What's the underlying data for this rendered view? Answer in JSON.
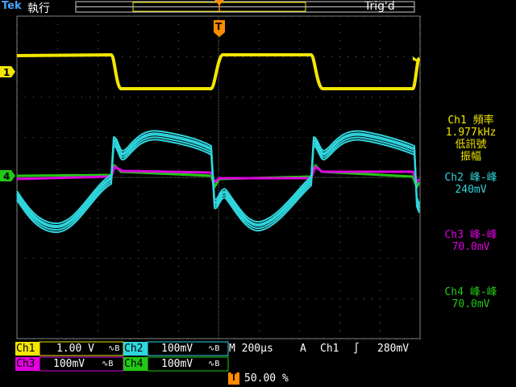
{
  "header": {
    "brand": "Tek",
    "mode": "執行",
    "trigger_status": "Trig'd"
  },
  "markers": {
    "ch1": "1",
    "ch4": "4",
    "trigger_pos": "T"
  },
  "measurements": [
    {
      "line1": "Ch1 頻率",
      "line2": "1.977kHz",
      "line3": "低訊號",
      "line4": "振幅",
      "color": "#f2e600"
    },
    {
      "line1": "Ch2 峰-峰",
      "line2": "240mV",
      "color": "#2fd6de"
    },
    {
      "line1": "Ch3 峰-峰",
      "line2": "70.0mV",
      "color": "#e000e0"
    },
    {
      "line1": "Ch4 峰-峰",
      "line2": "70.0mV",
      "color": "#22c814"
    }
  ],
  "bottom": {
    "ch1_label": "Ch1",
    "ch1_scale": "1.00 V",
    "ch2_label": "Ch2",
    "ch2_scale": "100mV",
    "ch3_label": "Ch3",
    "ch3_scale": "100mV",
    "ch4_label": "Ch4",
    "ch4_scale": "100mV",
    "bw_icon_text": "∿B",
    "timebase": "M 200μs",
    "trigger_mode": "A",
    "trigger_src": "Ch1",
    "trigger_slope": "∫",
    "trigger_level": "280mV",
    "trigger_position": "50.00 %"
  },
  "colors": {
    "ch1": "#f2e600",
    "ch2": "#2fd6de",
    "ch3": "#e000e0",
    "ch4": "#22c814",
    "grid": "#7a7a7a",
    "trigger_marker": "#ff8c00"
  }
}
